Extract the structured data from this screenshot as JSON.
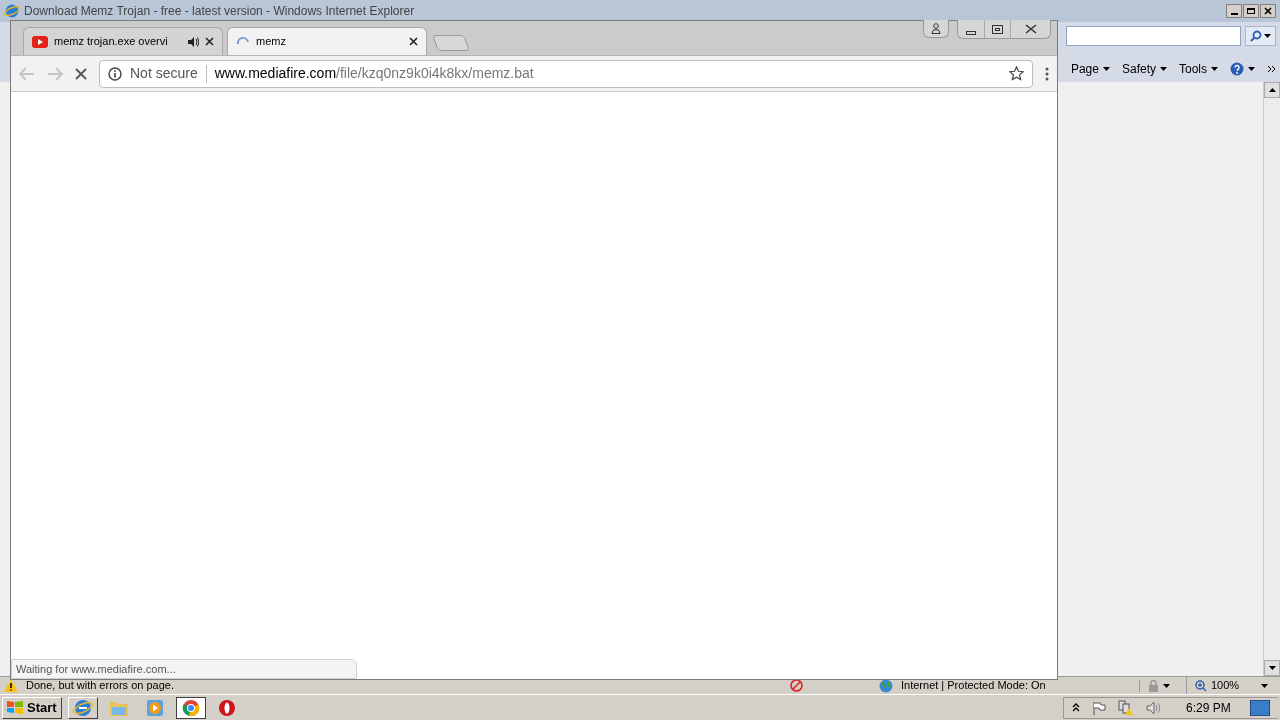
{
  "ie": {
    "title": "Download Memz Trojan - free - latest version - Windows Internet Explorer",
    "command_bar": [
      {
        "label": "Page"
      },
      {
        "label": "Safety"
      },
      {
        "label": "Tools"
      }
    ],
    "status_bar": {
      "message": "Done, but with errors on page.",
      "zone": "Internet | Protected Mode: On",
      "zoom": "100%"
    }
  },
  "chrome": {
    "tabs": [
      {
        "title": "memz trojan.exe overvi",
        "selected": false,
        "audio": true,
        "loading": false
      },
      {
        "title": "memz",
        "selected": true,
        "audio": false,
        "loading": true
      }
    ],
    "nav": {
      "back_disabled": true,
      "forward_disabled": true
    },
    "omnibox": {
      "security": "Not secure",
      "host": "www.mediafire.com",
      "path": "/file/kzq0nz9k0i4k8kx/memz.bat"
    },
    "status_bubble": "Waiting for www.mediafire.com..."
  },
  "taskbar": {
    "start": "Start",
    "apps": [
      {
        "kind": "ie",
        "selected": false
      },
      {
        "kind": "folder",
        "selected": false
      },
      {
        "kind": "media",
        "selected": false
      },
      {
        "kind": "chrome",
        "selected": true
      },
      {
        "kind": "opera",
        "selected": false
      }
    ],
    "clock": "6:29 PM"
  }
}
